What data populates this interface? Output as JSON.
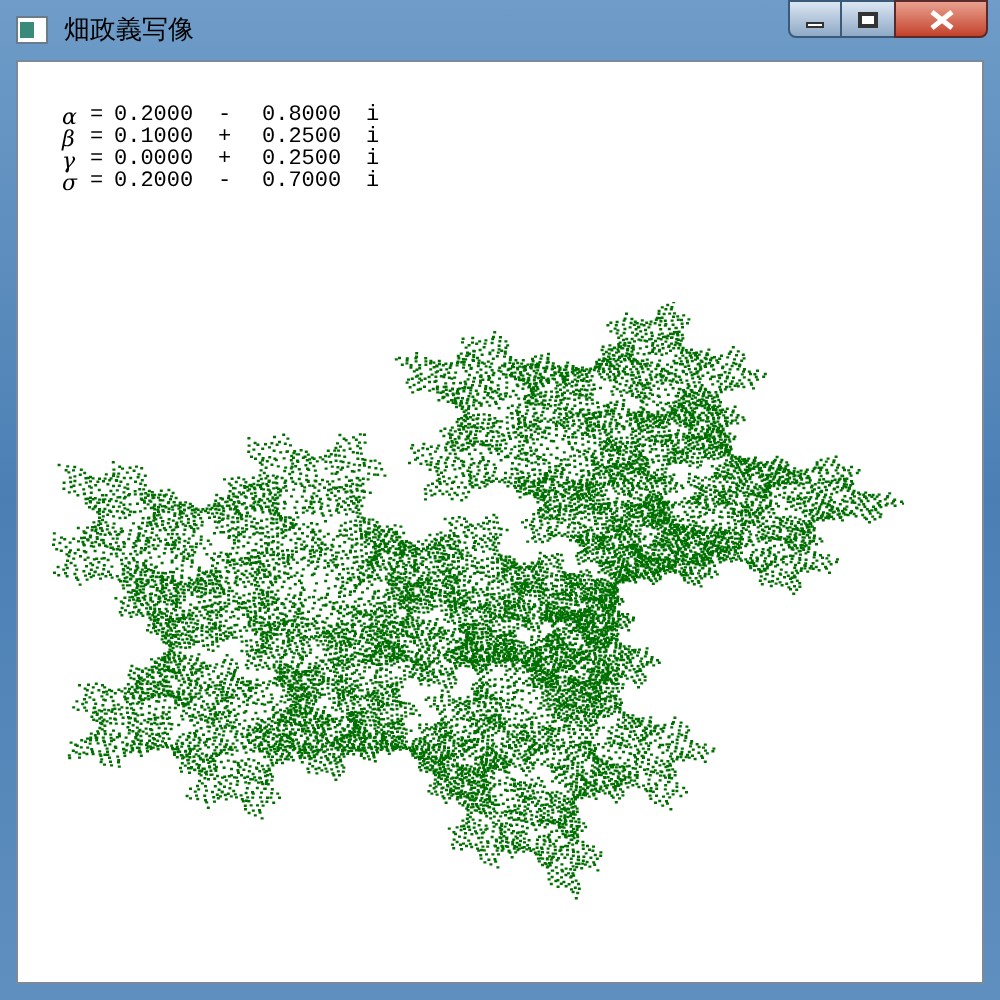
{
  "window": {
    "title": "畑政義写像"
  },
  "parameters": [
    {
      "symbol": "α",
      "equals": "=",
      "real": "0.2000",
      "operator": "-",
      "imaginary": "0.8000",
      "unit": "i"
    },
    {
      "symbol": "β",
      "equals": "=",
      "real": "0.1000",
      "operator": "+",
      "imaginary": "0.2500",
      "unit": "i"
    },
    {
      "symbol": "γ",
      "equals": "=",
      "real": "0.0000",
      "operator": "+",
      "imaginary": "0.2500",
      "unit": "i"
    },
    {
      "symbol": "σ",
      "equals": "=",
      "real": "0.2000",
      "operator": "-",
      "imaginary": "0.7000",
      "unit": "i"
    }
  ]
}
